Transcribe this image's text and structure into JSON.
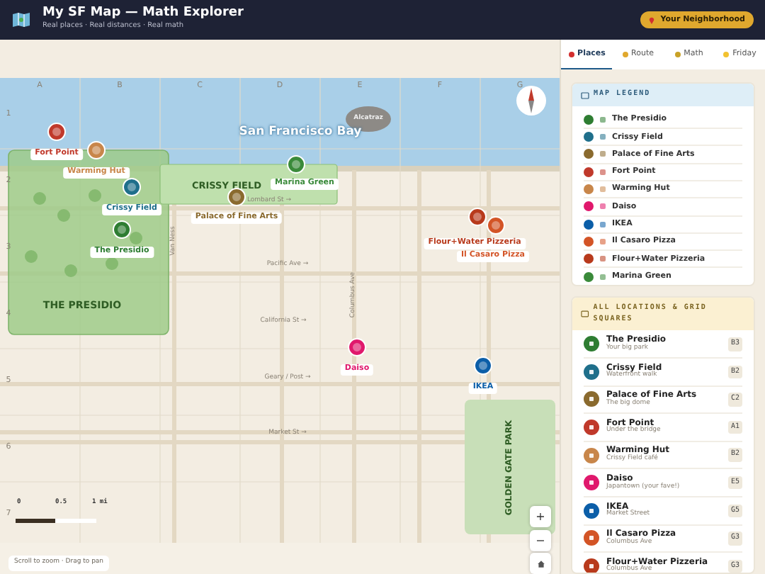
{
  "header": {
    "title": "My SF Map — Math Explorer",
    "subtitle": "Real places · Real distances · Real math",
    "badge": "Your Neighborhood"
  },
  "map": {
    "columns": [
      "A",
      "B",
      "C",
      "D",
      "E",
      "F",
      "G"
    ],
    "rows": [
      "1",
      "2",
      "3",
      "4",
      "5",
      "6",
      "7"
    ],
    "water_label": "San Francisco Bay",
    "island_label": "Alcatraz",
    "areas": [
      {
        "label": "THE PRESIDIO",
        "kind": "flat"
      },
      {
        "label": "CRISSY FIELD",
        "kind": "flat"
      },
      {
        "label": "GOLDEN GATE PARK",
        "kind": "vertical"
      }
    ],
    "streets": [
      {
        "label": "Lombard St →",
        "kind": "flat"
      },
      {
        "label": "Pacific Ave →",
        "kind": "flat"
      },
      {
        "label": "California St →",
        "kind": "flat"
      },
      {
        "label": "Geary / Post →",
        "kind": "flat"
      },
      {
        "label": "Market St →",
        "kind": "flat"
      },
      {
        "label": "Van Ness",
        "kind": "vertical"
      },
      {
        "label": "Columbus Ave",
        "kind": "vertical"
      }
    ],
    "markers": [
      {
        "label": "Fort Point",
        "color": "#c0392b"
      },
      {
        "label": "Warming Hut",
        "color": "#c8864a"
      },
      {
        "label": "Crissy Field",
        "color": "#1f6f8b"
      },
      {
        "label": "The Presidio",
        "color": "#2e7d32"
      },
      {
        "label": "Palace of Fine Arts",
        "color": "#8a6a2e"
      },
      {
        "label": "Marina Green",
        "color": "#3a8a3a"
      },
      {
        "label": "Flour+Water Pizzeria",
        "color": "#b83a1c"
      },
      {
        "label": "Il Casaro Pizza",
        "color": "#d35426"
      },
      {
        "label": "Daiso",
        "color": "#e0186c"
      },
      {
        "label": "IKEA",
        "color": "#0b5ea8"
      }
    ],
    "scale": [
      "0",
      "0.5",
      "1 mi"
    ],
    "zoom_in": "+",
    "zoom_out": "−",
    "hint": "Scroll to zoom · Drag to pan"
  },
  "tabs": [
    {
      "label": "Places",
      "selected": true
    },
    {
      "label": "Route",
      "selected": false
    },
    {
      "label": "Math",
      "selected": false
    },
    {
      "label": "Friday",
      "selected": false
    }
  ],
  "legend": {
    "title": "MAP LEGEND",
    "items": [
      {
        "label": "The Presidio",
        "color": "#2e7d32"
      },
      {
        "label": "Crissy Field",
        "color": "#1f6f8b"
      },
      {
        "label": "Palace of Fine Arts",
        "color": "#8a6a2e"
      },
      {
        "label": "Fort Point",
        "color": "#c0392b"
      },
      {
        "label": "Warming Hut",
        "color": "#c8864a"
      },
      {
        "label": "Daiso",
        "color": "#e0186c"
      },
      {
        "label": "IKEA",
        "color": "#0b5ea8"
      },
      {
        "label": "Il Casaro Pizza",
        "color": "#d35426"
      },
      {
        "label": "Flour+Water Pizzeria",
        "color": "#b83a1c"
      },
      {
        "label": "Marina Green",
        "color": "#3a8a3a"
      }
    ]
  },
  "locations": {
    "title": "ALL LOCATIONS & GRID SQUARES",
    "items": [
      {
        "name": "The Presidio",
        "sub": "Your big park",
        "grid": "B3",
        "color": "#2e7d32"
      },
      {
        "name": "Crissy Field",
        "sub": "Waterfront walk",
        "grid": "B2",
        "color": "#1f6f8b"
      },
      {
        "name": "Palace of Fine Arts",
        "sub": "The big dome",
        "grid": "C2",
        "color": "#8a6a2e"
      },
      {
        "name": "Fort Point",
        "sub": "Under the bridge",
        "grid": "A1",
        "color": "#c0392b"
      },
      {
        "name": "Warming Hut",
        "sub": "Crissy Field café",
        "grid": "B2",
        "color": "#c8864a"
      },
      {
        "name": "Daiso",
        "sub": "Japantown (your fave!)",
        "grid": "E5",
        "color": "#e0186c"
      },
      {
        "name": "IKEA",
        "sub": "Market Street",
        "grid": "G5",
        "color": "#0b5ea8"
      },
      {
        "name": "Il Casaro Pizza",
        "sub": "Columbus Ave",
        "grid": "G3",
        "color": "#d35426"
      },
      {
        "name": "Flour+Water Pizzeria",
        "sub": "Columbus Ave",
        "grid": "G3",
        "color": "#b83a1c"
      }
    ]
  }
}
